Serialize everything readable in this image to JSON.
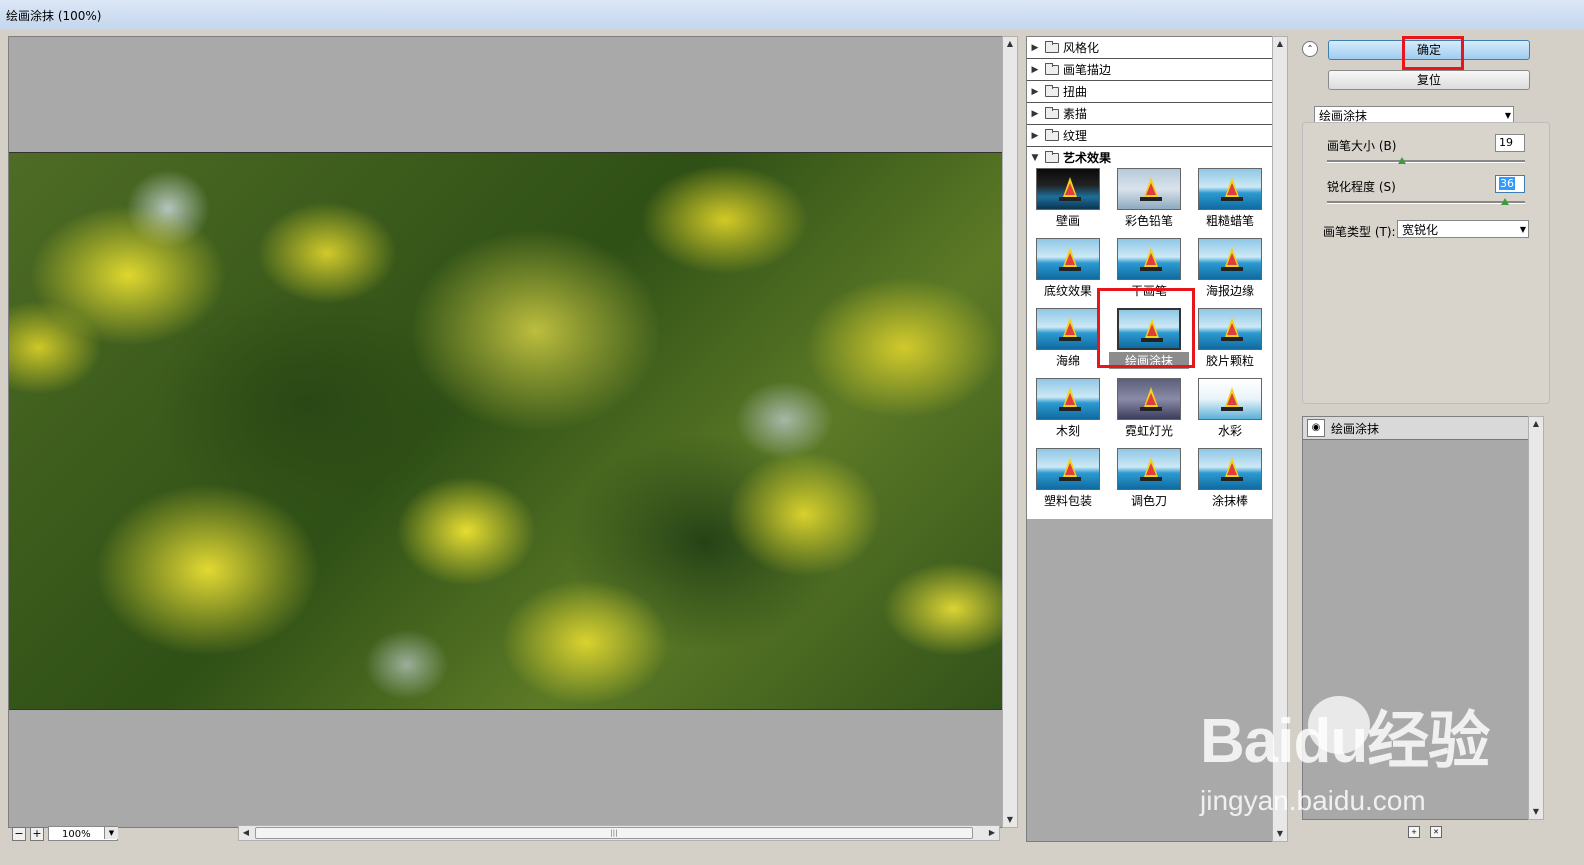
{
  "window": {
    "title": "绘画涂抹 (100%)"
  },
  "preview": {
    "zoom_value": "100%"
  },
  "gallery": {
    "folders": [
      {
        "label": "风格化",
        "expanded": false
      },
      {
        "label": "画笔描边",
        "expanded": false
      },
      {
        "label": "扭曲",
        "expanded": false
      },
      {
        "label": "素描",
        "expanded": false
      },
      {
        "label": "纹理",
        "expanded": false
      },
      {
        "label": "艺术效果",
        "expanded": true
      }
    ],
    "filters": [
      {
        "label": "壁画",
        "style": "dark"
      },
      {
        "label": "彩色铅笔",
        "style": "sketch"
      },
      {
        "label": "粗糙蜡笔",
        "style": "normal"
      },
      {
        "label": "底纹效果",
        "style": "normal"
      },
      {
        "label": "干画笔",
        "style": "normal"
      },
      {
        "label": "海报边缘",
        "style": "normal"
      },
      {
        "label": "海绵",
        "style": "normal"
      },
      {
        "label": "绘画涂抹",
        "style": "normal",
        "selected": true
      },
      {
        "label": "胶片颗粒",
        "style": "normal"
      },
      {
        "label": "木刻",
        "style": "normal"
      },
      {
        "label": "霓虹灯光",
        "style": "neon"
      },
      {
        "label": "水彩",
        "style": "wc"
      },
      {
        "label": "塑料包装",
        "style": "normal"
      },
      {
        "label": "调色刀",
        "style": "normal"
      },
      {
        "label": "涂抹棒",
        "style": "normal"
      }
    ]
  },
  "buttons": {
    "ok_label": "确定",
    "reset_label": "复位"
  },
  "filter_select": {
    "value": "绘画涂抹"
  },
  "params": {
    "brush_size": {
      "label": "画笔大小 (B)",
      "value": "19",
      "fraction": 0.38
    },
    "sharpness": {
      "label": "锐化程度 (S)",
      "value": "36",
      "fraction": 0.9
    },
    "brush_type": {
      "label": "画笔类型 (T):",
      "value": "宽锐化"
    }
  },
  "layers": {
    "items": [
      {
        "label": "绘画涂抹"
      }
    ]
  },
  "watermark": {
    "main": "Baidu经验",
    "sub": "jingyan.baidu.com"
  },
  "colors": {
    "highlight": "#e8161b",
    "panel": "#d4d0c8",
    "preview_bg": "#a9a9a9"
  }
}
